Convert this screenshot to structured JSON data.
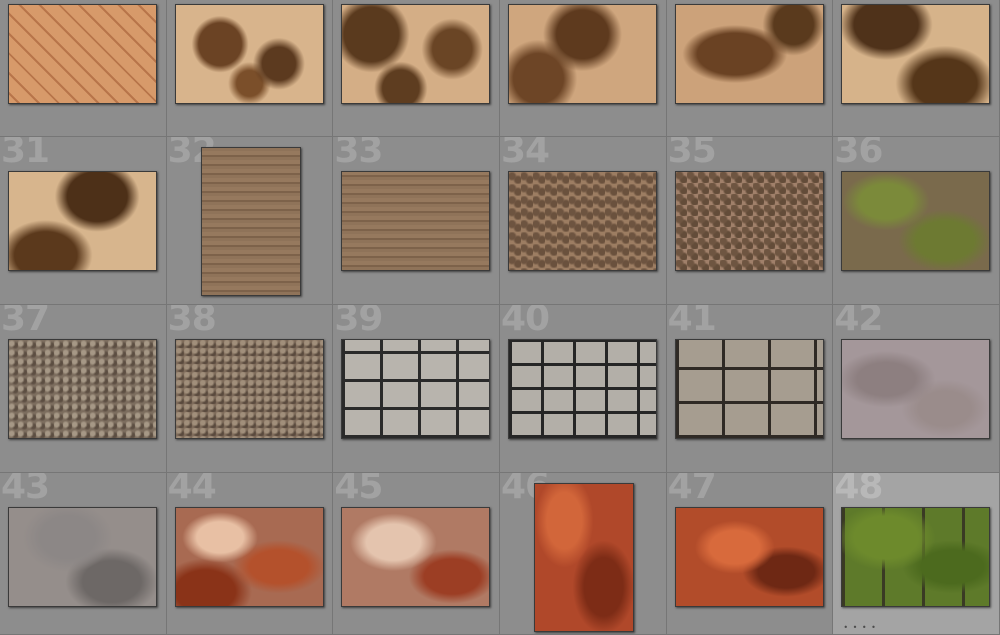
{
  "grid": {
    "cells": [
      {
        "num": "",
        "texture": "tx-diamond",
        "orientation": "land"
      },
      {
        "num": "",
        "texture": "tx-rust-1",
        "orientation": "land"
      },
      {
        "num": "",
        "texture": "tx-rust-2",
        "orientation": "land"
      },
      {
        "num": "",
        "texture": "tx-rust-3",
        "orientation": "land"
      },
      {
        "num": "",
        "texture": "tx-rust-4",
        "orientation": "land"
      },
      {
        "num": "",
        "texture": "tx-rust-5",
        "orientation": "land"
      },
      {
        "num": "31",
        "texture": "tx-rust-6",
        "orientation": "land"
      },
      {
        "num": "32",
        "texture": "tx-wood",
        "orientation": "port"
      },
      {
        "num": "33",
        "texture": "tx-wood",
        "orientation": "land"
      },
      {
        "num": "34",
        "texture": "tx-gravel-a",
        "orientation": "land"
      },
      {
        "num": "35",
        "texture": "tx-gravel-b",
        "orientation": "land"
      },
      {
        "num": "36",
        "texture": "tx-moss",
        "orientation": "land"
      },
      {
        "num": "37",
        "texture": "tx-pebble-a",
        "orientation": "land"
      },
      {
        "num": "38",
        "texture": "tx-pebble-b",
        "orientation": "land"
      },
      {
        "num": "39",
        "texture": "tx-stonewall-a",
        "orientation": "land"
      },
      {
        "num": "40",
        "texture": "tx-stonewall-b",
        "orientation": "land"
      },
      {
        "num": "41",
        "texture": "tx-stonewall-c",
        "orientation": "land"
      },
      {
        "num": "42",
        "texture": "tx-plaster",
        "orientation": "land"
      },
      {
        "num": "43",
        "texture": "tx-rockface",
        "orientation": "land"
      },
      {
        "num": "44",
        "texture": "tx-clay-a",
        "orientation": "land"
      },
      {
        "num": "45",
        "texture": "tx-clay-b",
        "orientation": "land"
      },
      {
        "num": "46",
        "texture": "tx-clay-c",
        "orientation": "port"
      },
      {
        "num": "47",
        "texture": "tx-clay-d",
        "orientation": "land"
      },
      {
        "num": "48",
        "texture": "tx-mossstone",
        "orientation": "land",
        "selected": true,
        "badge": "• • • •"
      }
    ]
  }
}
